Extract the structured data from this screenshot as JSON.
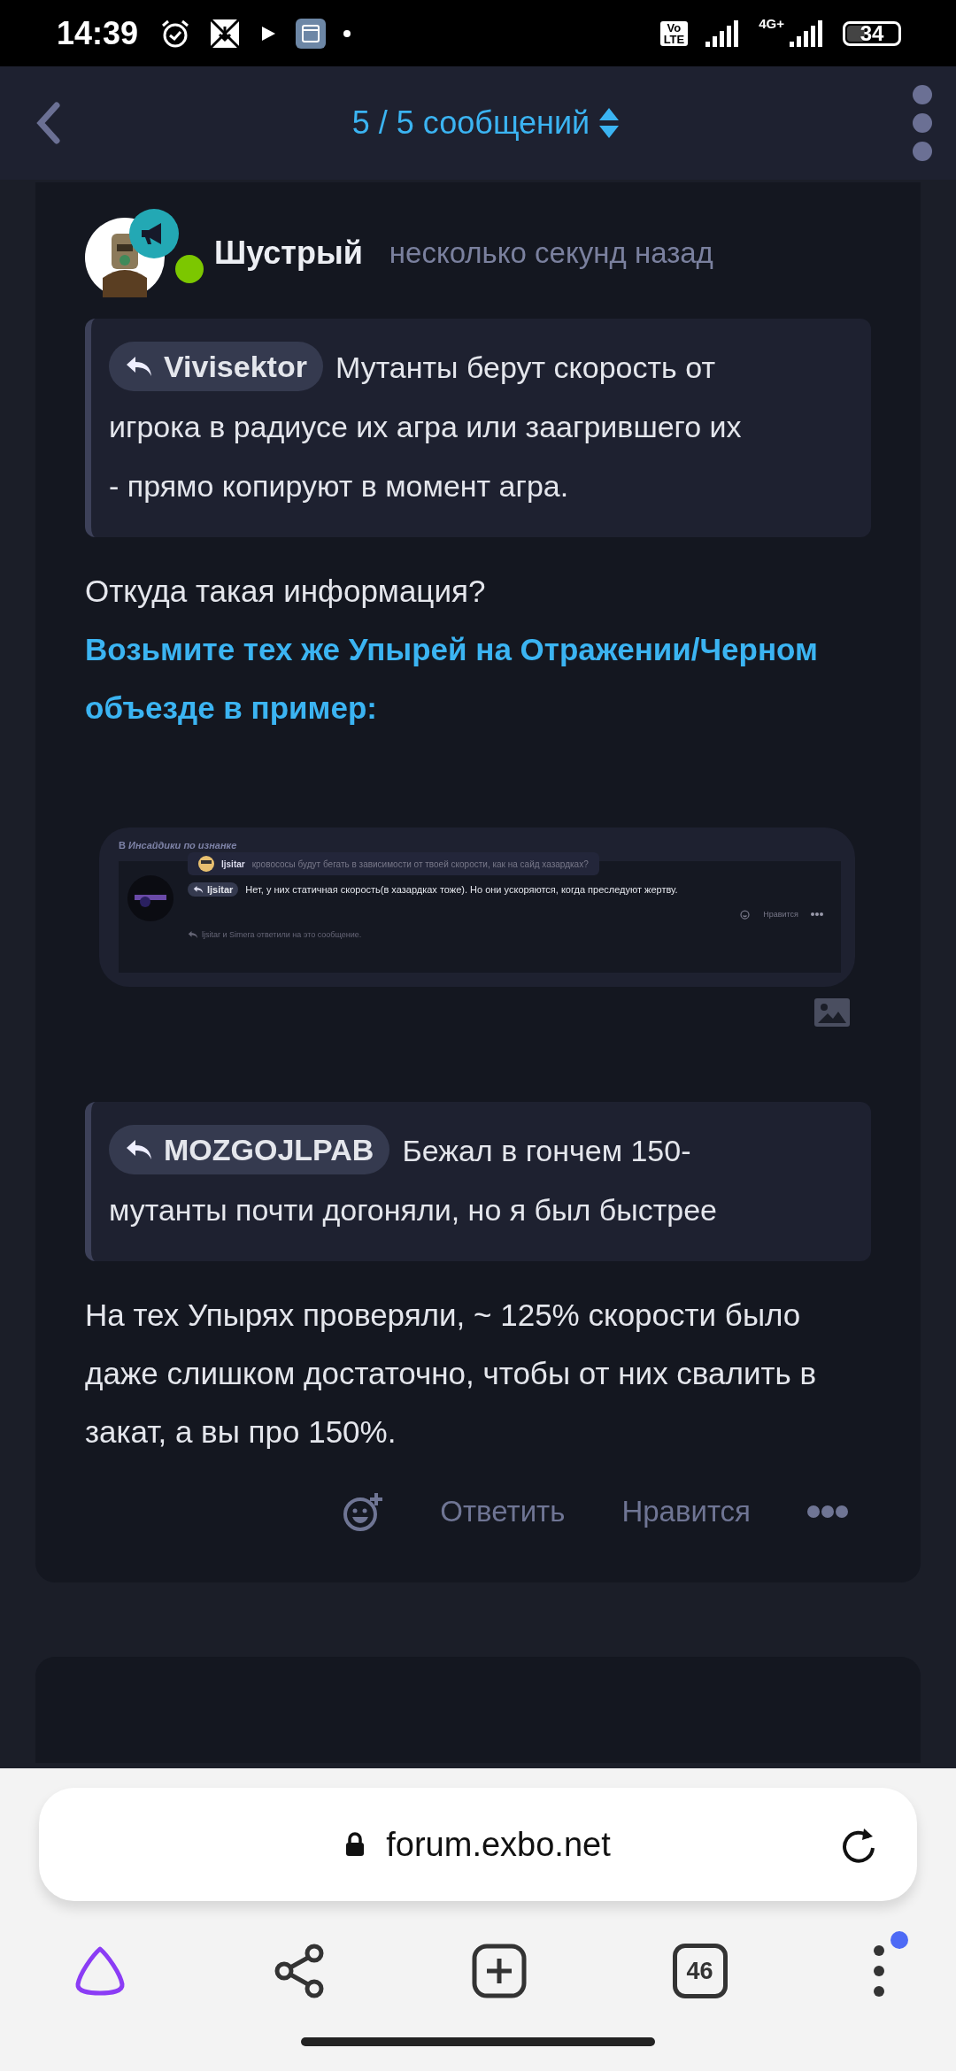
{
  "status_bar": {
    "time": "14:39",
    "volte": [
      "Vo",
      "LTE"
    ],
    "network": "4G+",
    "battery": "34"
  },
  "header": {
    "title": "5 / 5 сообщений"
  },
  "post": {
    "author": "Шустрый",
    "online": true,
    "time": "несколько секунд назад",
    "quote1": {
      "user": "Vivisektor",
      "lines": [
        "Мутанты берут скорость от",
        "игрока в радиусе их агра или заагрившего их",
        "- прямо копируют в момент агра."
      ]
    },
    "question": "Откуда такая информация?",
    "link": "Возьмите тех же Упырей на Отражении/Черном объезде в пример:",
    "embed": {
      "thread": "В *Инсайдики по изнанке*",
      "popup_user": "ljsitar",
      "popup_text": "кровососы будут бегать в зависимости от твоей скорости, как на сайд хазардках?",
      "reply_user": "ljsitar",
      "reply_text": "Нет, у них статичная скорость(в хазардках тоже). Но они ускоряются, когда преследуют жертву.",
      "like": "Нравится",
      "replied": "ljsitar и Simera ответили на это сообщение."
    },
    "quote2": {
      "user": "MOZGOJLPAB",
      "lines": [
        "Бежал в гончем 150-",
        "мутанты почти догоняли, но я был быстрее"
      ]
    },
    "answer": "На тех Упырях проверяли, ~ 125% скорости было даже слишком достаточно, чтобы от них свалить в закат, а вы про 150%.",
    "actions": [
      "Ответить",
      "Нравится"
    ]
  },
  "browser": {
    "url": "forum.exbo.net",
    "tabs": "46",
    "notification": true
  }
}
